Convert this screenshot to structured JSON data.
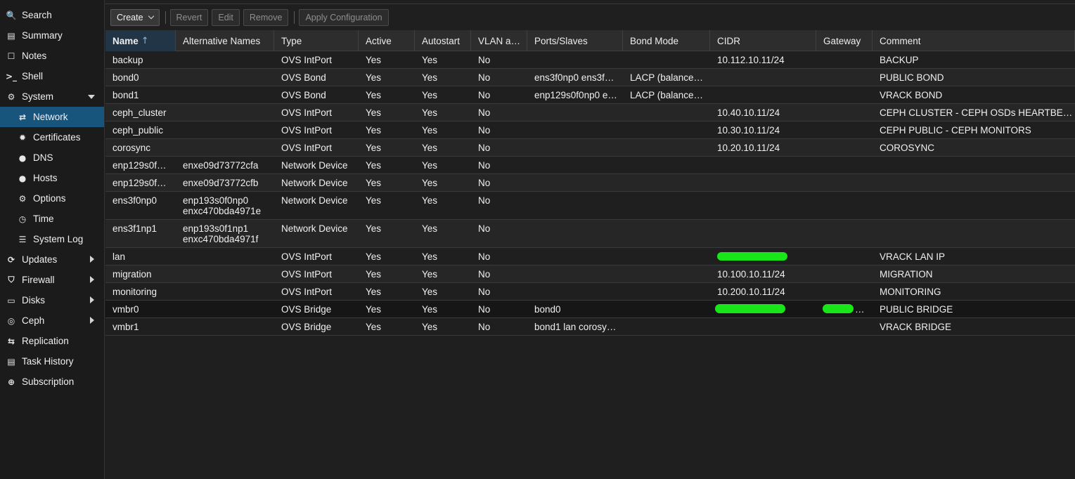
{
  "sidebar": {
    "items": [
      {
        "label": "Search",
        "icon": "search-icon",
        "glyph": "🔍",
        "level": 0
      },
      {
        "label": "Summary",
        "icon": "book-icon",
        "glyph": "▤",
        "level": 0
      },
      {
        "label": "Notes",
        "icon": "notes-icon",
        "glyph": "☐",
        "level": 0
      },
      {
        "label": "Shell",
        "icon": "terminal-icon",
        "glyph": ">_",
        "level": 0
      },
      {
        "label": "System",
        "icon": "cogs-icon",
        "glyph": "⚙",
        "level": 0,
        "arrow": "down"
      },
      {
        "label": "Network",
        "icon": "exchange-icon",
        "glyph": "⇄",
        "level": 1,
        "active": true
      },
      {
        "label": "Certificates",
        "icon": "certificate-icon",
        "glyph": "✹",
        "level": 1
      },
      {
        "label": "DNS",
        "icon": "globe-icon",
        "glyph": "●",
        "level": 1
      },
      {
        "label": "Hosts",
        "icon": "globe-icon",
        "glyph": "●",
        "level": 1
      },
      {
        "label": "Options",
        "icon": "gear-icon",
        "glyph": "⚙",
        "level": 1
      },
      {
        "label": "Time",
        "icon": "clock-icon",
        "glyph": "◷",
        "level": 1
      },
      {
        "label": "System Log",
        "icon": "list-icon",
        "glyph": "☰",
        "level": 1
      },
      {
        "label": "Updates",
        "icon": "refresh-icon",
        "glyph": "⟳",
        "level": 0,
        "arrow": "right"
      },
      {
        "label": "Firewall",
        "icon": "shield-icon",
        "glyph": "⛉",
        "level": 0,
        "arrow": "right"
      },
      {
        "label": "Disks",
        "icon": "hdd-icon",
        "glyph": "▭",
        "level": 0,
        "arrow": "right"
      },
      {
        "label": "Ceph",
        "icon": "ceph-icon",
        "glyph": "◎",
        "level": 0,
        "arrow": "right"
      },
      {
        "label": "Replication",
        "icon": "retweet-icon",
        "glyph": "⇆",
        "level": 0
      },
      {
        "label": "Task History",
        "icon": "list-alt-icon",
        "glyph": "▤",
        "level": 0
      },
      {
        "label": "Subscription",
        "icon": "support-icon",
        "glyph": "⊕",
        "level": 0
      }
    ]
  },
  "toolbar": {
    "create_label": "Create",
    "revert_label": "Revert",
    "edit_label": "Edit",
    "remove_label": "Remove",
    "apply_label": "Apply Configuration"
  },
  "grid": {
    "sort_indicator": "↑",
    "columns": [
      "Name",
      "Alternative Names",
      "Type",
      "Active",
      "Autostart",
      "VLAN a…",
      "Ports/Slaves",
      "Bond Mode",
      "CIDR",
      "Gateway",
      "Comment"
    ],
    "rows": [
      {
        "cells": [
          "backup",
          "",
          "OVS IntPort",
          "Yes",
          "Yes",
          "No",
          "",
          "",
          "10.112.10.11/24",
          "",
          "BACKUP"
        ]
      },
      {
        "cells": [
          "bond0",
          "",
          "OVS Bond",
          "Yes",
          "Yes",
          "No",
          "ens3f0np0 ens3f…",
          "LACP (balance…",
          "",
          "",
          "PUBLIC BOND"
        ]
      },
      {
        "cells": [
          "bond1",
          "",
          "OVS Bond",
          "Yes",
          "Yes",
          "No",
          "enp129s0f0np0 e…",
          "LACP (balance…",
          "",
          "",
          "VRACK BOND"
        ]
      },
      {
        "cells": [
          "ceph_cluster",
          "",
          "OVS IntPort",
          "Yes",
          "Yes",
          "No",
          "",
          "",
          "10.40.10.11/24",
          "",
          "CEPH CLUSTER - CEPH OSDs HEARTBE…"
        ]
      },
      {
        "cells": [
          "ceph_public",
          "",
          "OVS IntPort",
          "Yes",
          "Yes",
          "No",
          "",
          "",
          "10.30.10.11/24",
          "",
          "CEPH PUBLIC - CEPH MONITORS"
        ]
      },
      {
        "cells": [
          "corosync",
          "",
          "OVS IntPort",
          "Yes",
          "Yes",
          "No",
          "",
          "",
          "10.20.10.11/24",
          "",
          "COROSYNC"
        ]
      },
      {
        "cells": [
          "enp129s0f…",
          "enxe09d73772cfa",
          "Network Device",
          "Yes",
          "Yes",
          "No",
          "",
          "",
          "",
          "",
          ""
        ]
      },
      {
        "cells": [
          "enp129s0f…",
          "enxe09d73772cfb",
          "Network Device",
          "Yes",
          "Yes",
          "No",
          "",
          "",
          "",
          "",
          ""
        ]
      },
      {
        "cells": [
          "ens3f0np0",
          "enp193s0f0np0",
          "Network Device",
          "Yes",
          "Yes",
          "No",
          "",
          "",
          "",
          "",
          ""
        ],
        "alt2": "enxc470bda4971e"
      },
      {
        "cells": [
          "ens3f1np1",
          "enp193s0f1np1",
          "Network Device",
          "Yes",
          "Yes",
          "No",
          "",
          "",
          "",
          "",
          ""
        ],
        "alt2": "enxc470bda4971f"
      },
      {
        "cells": [
          "lan",
          "",
          "OVS IntPort",
          "Yes",
          "Yes",
          "No",
          "",
          "",
          "",
          "",
          "VRACK LAN IP"
        ],
        "redact_cidr": true
      },
      {
        "cells": [
          "migration",
          "",
          "OVS IntPort",
          "Yes",
          "Yes",
          "No",
          "",
          "",
          "10.100.10.11/24",
          "",
          "MIGRATION"
        ]
      },
      {
        "cells": [
          "monitoring",
          "",
          "OVS IntPort",
          "Yes",
          "Yes",
          "No",
          "",
          "",
          "10.200.10.11/24",
          "",
          "MONITORING"
        ]
      },
      {
        "cells": [
          "vmbr0",
          "",
          "OVS Bridge",
          "Yes",
          "Yes",
          "No",
          "bond0",
          "",
          "",
          "…",
          "PUBLIC BRIDGE"
        ],
        "redact_cidr": true,
        "redact_gw": true,
        "selected": true
      },
      {
        "cells": [
          "vmbr1",
          "",
          "OVS Bridge",
          "Yes",
          "Yes",
          "No",
          "bond1 lan corosy…",
          "",
          "",
          "",
          "VRACK BRIDGE"
        ]
      }
    ]
  },
  "colors": {
    "accent": "#17557d",
    "redaction": "#19e619",
    "background": "#1f1f1f"
  }
}
